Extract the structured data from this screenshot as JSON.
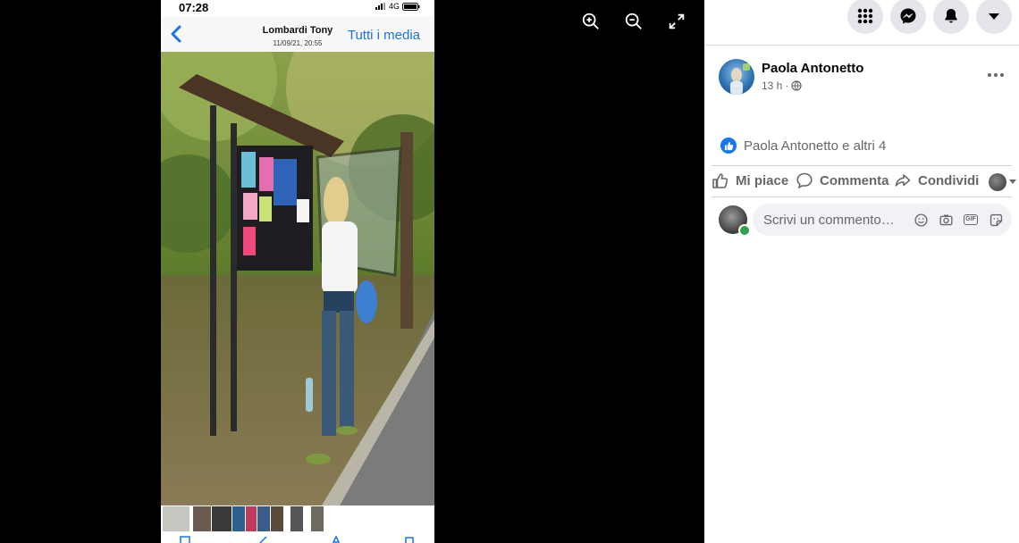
{
  "viewer": {
    "controls": [
      {
        "name": "zoom-in-icon"
      },
      {
        "name": "zoom-out-icon"
      },
      {
        "name": "fullscreen-icon"
      }
    ],
    "phone": {
      "time": "07:28",
      "network": "4G",
      "contact_name": "Lombardi Tony",
      "date": "11/09/21, 20:55",
      "all_media_label": "Tutti i media"
    }
  },
  "topbar": {
    "buttons": [
      "menu-grid-icon",
      "messenger-icon",
      "notifications-icon",
      "account-dropdown-icon"
    ]
  },
  "post": {
    "author": "Paola Antonetto",
    "time": "13 h",
    "time_separator": "·",
    "privacy_icon": "globe-icon",
    "reactions_text": "Paola Antonetto e altri 4",
    "actions": {
      "like": "Mi piace",
      "comment": "Commenta",
      "share": "Condividi"
    },
    "comment_placeholder": "Scrivi un commento…",
    "comment_icons": [
      "emoji-icon",
      "camera-icon",
      "gif-icon",
      "sticker-icon"
    ],
    "gif_label": "GIF"
  },
  "colors": {
    "facebook_blue": "#1877f2",
    "ios_blue": "#1a73e8",
    "online_green": "#31a24c",
    "secondary_text": "#65676b"
  }
}
